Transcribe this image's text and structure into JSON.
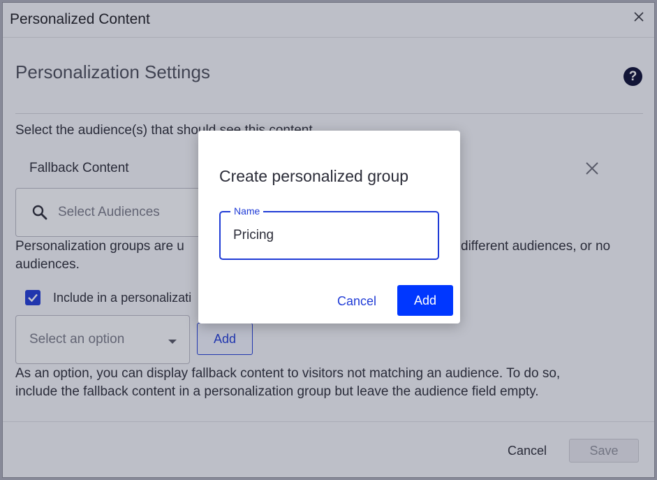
{
  "window": {
    "title": "Personalized Content"
  },
  "settings": {
    "title": "Personalization Settings",
    "audience_prompt": "Select the audience(s) that should see this content",
    "fallback_label": "Fallback Content",
    "audience_placeholder": "Select Audiences",
    "groups_text_left": "Personalization groups are u",
    "groups_text_right": "different audiences, or no",
    "groups_text_line2": "audiences.",
    "include_label": "Include in a personalizati",
    "select_placeholder": "Select an option",
    "add_label": "Add",
    "fallback_note_line1": "As an option, you can display fallback content to visitors not matching an audience. To do so,",
    "fallback_note_line2": "include the fallback content in a personalization group but leave the audience field empty."
  },
  "footer": {
    "cancel_label": "Cancel",
    "save_label": "Save"
  },
  "dialog": {
    "title": "Create personalized group",
    "name_label": "Name",
    "name_value": "Pricing",
    "cancel_label": "Cancel",
    "add_label": "Add"
  },
  "colors": {
    "accent": "#1f3bd6",
    "primary_button": "#0037ff",
    "help_icon": "#0c0e35"
  }
}
